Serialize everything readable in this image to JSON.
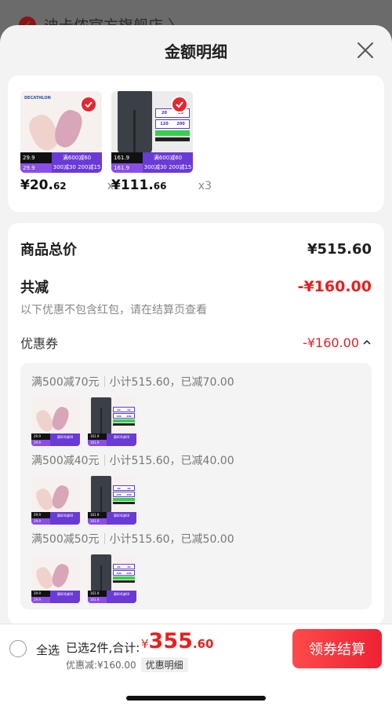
{
  "background": {
    "store_name": "迪卡侬官方旗舰店 〉"
  },
  "sheet": {
    "title": "金额明细"
  },
  "products": [
    {
      "name": "socks",
      "brand": "DECATHLON",
      "price_int": "¥20.",
      "price_dec": "62",
      "qty": "x1",
      "tag_price": "29.9",
      "promo_line1": "满600减60",
      "promo_line2": "300减30 200减15"
    },
    {
      "name": "pants",
      "brand": "",
      "price_int": "¥111.",
      "price_dec": "66",
      "qty": "x3",
      "tag_price": "161.9",
      "promo_line1": "满600减60",
      "promo_line2": "300减30 200减15"
    }
  ],
  "summary": {
    "total_label": "商品总价",
    "total_value": "¥515.60",
    "reduce_label": "共减",
    "reduce_value": "-¥160.00",
    "note": "以下优惠不包含红包，请在结算页查看",
    "coupon_label": "优惠券",
    "coupon_value": "-¥160.00"
  },
  "coupon_details": [
    {
      "rule": "满500减70元",
      "detail": "小计515.60，已减70.00"
    },
    {
      "rule": "满500减40元",
      "detail": "小计515.60，已减40.00"
    },
    {
      "rule": "满500减50元",
      "detail": "小计515.60，已减50.00"
    }
  ],
  "mini_texts": {
    "socks_price": "29.9",
    "pants_price": "161.9",
    "promo": "满600减60"
  },
  "coupon_mini": {
    "a": "20",
    "b": "50",
    "c": "120",
    "d": "200"
  },
  "bottom": {
    "select_all": "全选",
    "selected": "已选2件,合计:",
    "currency": "¥",
    "amount_int": "355",
    "amount_dec": ".60",
    "discount": "优惠减:¥160.00",
    "detail_chip": "优惠明细",
    "checkout": "领券结算"
  },
  "colors": {
    "accent": "#e72020",
    "checkout": "#ee2232",
    "promo_purple": "#6a3ad6"
  }
}
